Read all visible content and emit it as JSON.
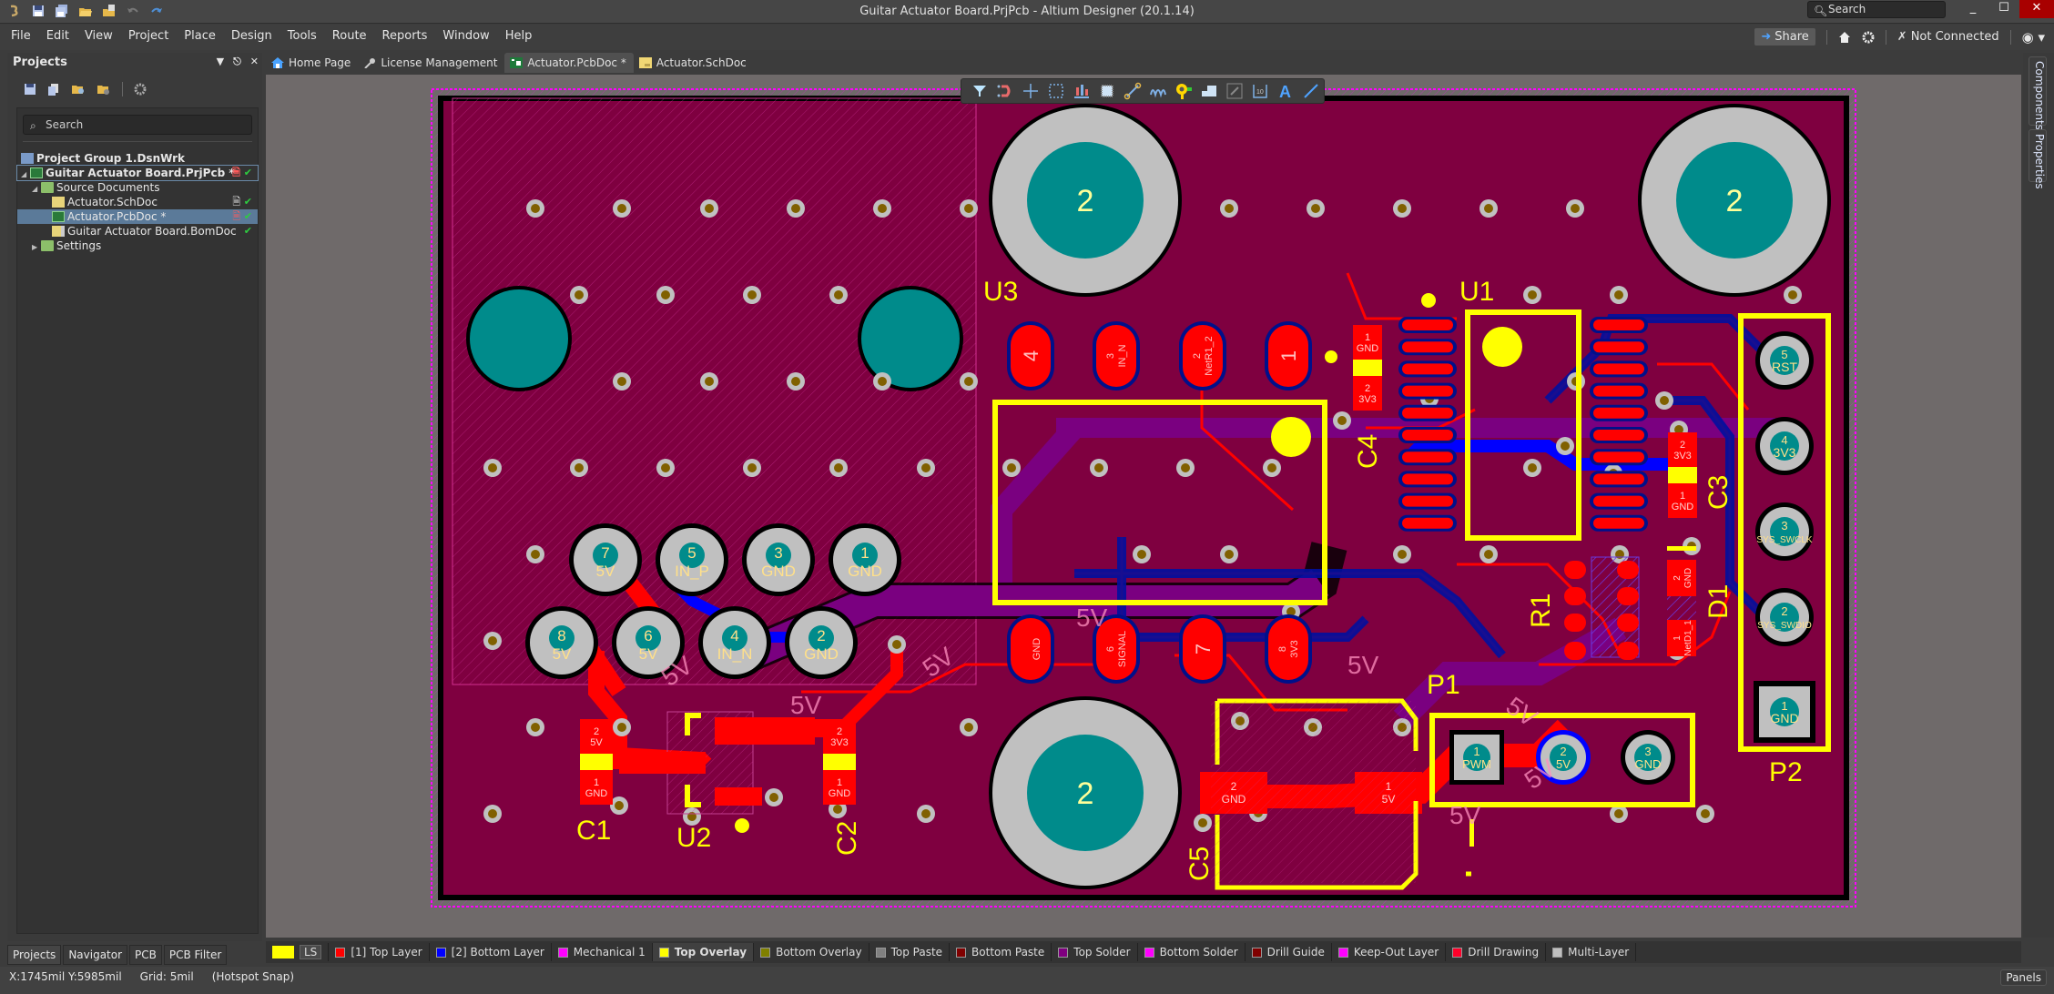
{
  "window": {
    "title": "Guitar Actuator Board.PrjPcb - Altium Designer (20.1.14)",
    "search_placeholder": "Search",
    "minimize": "_",
    "maximize": "☐",
    "close": "✕"
  },
  "menu": {
    "items": [
      "File",
      "Edit",
      "View",
      "Project",
      "Place",
      "Design",
      "Tools",
      "Route",
      "Reports",
      "Window",
      "Help"
    ],
    "share_label": "Share",
    "connection_status": "Not Connected"
  },
  "projects_panel": {
    "title": "Projects",
    "search_placeholder": "Search",
    "tree": [
      {
        "label": "Project Group 1.DsnWrk",
        "type": "group"
      },
      {
        "label": "Guitar Actuator Board.PrjPcb *",
        "type": "project",
        "modified": true,
        "status": "ok"
      },
      {
        "label": "Source Documents",
        "type": "folder"
      },
      {
        "label": "Actuator.SchDoc",
        "type": "sch",
        "status": "ok"
      },
      {
        "label": "Actuator.PcbDoc *",
        "type": "pcb",
        "modified": true,
        "selected": true,
        "status": "ok"
      },
      {
        "label": "Guitar Actuator Board.BomDoc",
        "type": "bom",
        "status": "ok"
      },
      {
        "label": "Settings",
        "type": "folder"
      }
    ]
  },
  "panel_tabs": [
    "Projects",
    "Navigator",
    "PCB",
    "PCB Filter"
  ],
  "doc_tabs": [
    {
      "label": "Home Page",
      "icon": "home-icon"
    },
    {
      "label": "License Management",
      "icon": "key-icon"
    },
    {
      "label": "Actuator.PcbDoc *",
      "icon": "pcb-doc-icon",
      "active": true
    },
    {
      "label": "Actuator.SchDoc",
      "icon": "sch-doc-icon"
    }
  ],
  "right_rail": [
    "Components",
    "Properties"
  ],
  "pcb_toolbar": [
    "filter-icon",
    "interactive-routing-icon",
    "move-crosshair-icon",
    "select-rect-icon",
    "align-icon",
    "place-component-icon",
    "route-icon",
    "length-tune-icon",
    "via-icon",
    "polygon-icon",
    "fill-icon",
    "dimension-icon",
    "string-icon",
    "line-icon"
  ],
  "layers": {
    "ls_label": "LS",
    "tabs": [
      {
        "label": "[1] Top Layer",
        "color": "#ff0000"
      },
      {
        "label": "[2] Bottom Layer",
        "color": "#0000ff"
      },
      {
        "label": "Mechanical 1",
        "color": "#ff00ff"
      },
      {
        "label": "Top Overlay",
        "color": "#ffff00",
        "active": true
      },
      {
        "label": "Bottom Overlay",
        "color": "#808000"
      },
      {
        "label": "Top Paste",
        "color": "#808080"
      },
      {
        "label": "Bottom Paste",
        "color": "#800000"
      },
      {
        "label": "Top Solder",
        "color": "#800080"
      },
      {
        "label": "Bottom Solder",
        "color": "#ff00ff"
      },
      {
        "label": "Drill Guide",
        "color": "#800000"
      },
      {
        "label": "Keep-Out Layer",
        "color": "#ff00ff"
      },
      {
        "label": "Drill Drawing",
        "color": "#ff002a"
      },
      {
        "label": "Multi-Layer",
        "color": "#c0c0c0"
      }
    ]
  },
  "status": {
    "coords": "X:1745mil Y:5985mil",
    "grid": "Grid: 5mil",
    "snap": "(Hotspot Snap)",
    "panels_label": "Panels"
  },
  "pcb": {
    "colors": {
      "board": "#7f0040",
      "top_layer": "#ff0000",
      "bottom_layer": "#0000ff",
      "overlay": "#ffff00",
      "multi_layer": "#c0c0c0",
      "drill": "#008b8b",
      "keepout": "#ff00ff"
    },
    "designators": {
      "U1": "U1",
      "U2": "U2",
      "U3": "U3",
      "C1": "C1",
      "C2": "C2",
      "C3": "C3",
      "C4": "C4",
      "C5": "C5",
      "R1": "R1",
      "D1": "D1",
      "P1": "P1",
      "P2": "P2",
      "P1_pin1_marker": "1"
    },
    "mount_hole_label": "2",
    "connector_left_pins": [
      {
        "num": "7",
        "net": "5V"
      },
      {
        "num": "5",
        "net": "IN_P"
      },
      {
        "num": "3",
        "net": "GND"
      },
      {
        "num": "1",
        "net": "GND"
      },
      {
        "num": "8",
        "net": "5V"
      },
      {
        "num": "6",
        "net": "5V"
      },
      {
        "num": "4",
        "net": "IN_N"
      },
      {
        "num": "2",
        "net": "GND"
      }
    ],
    "u3_top_pads": [
      {
        "num": "4",
        "net": ""
      },
      {
        "num": "3",
        "net": "IN_N"
      },
      {
        "num": "2",
        "net": "NetR1_2"
      },
      {
        "num": "1",
        "net": ""
      }
    ],
    "u3_bottom_pads": [
      {
        "num": "",
        "net": "GND"
      },
      {
        "num": "6",
        "net": "SIGNAL"
      },
      {
        "num": "7",
        "net": ""
      },
      {
        "num": "8",
        "net": "3V3"
      }
    ],
    "p2_pins": [
      {
        "num": "5",
        "net": "RST"
      },
      {
        "num": "4",
        "net": "3V3"
      },
      {
        "num": "3",
        "net": "SYS_SWCLK"
      },
      {
        "num": "2",
        "net": "SYS_SWDIO"
      },
      {
        "num": "1",
        "net": "GND"
      }
    ],
    "p1_pins": [
      {
        "num": "1",
        "net": "PWM"
      },
      {
        "num": "2",
        "net": "5V"
      },
      {
        "num": "3",
        "net": "GND"
      }
    ],
    "cap_pads": {
      "c1": [
        {
          "num": "2",
          "net": "5V"
        },
        {
          "num": "1",
          "net": "GND"
        }
      ],
      "c2": [
        {
          "num": "2",
          "net": "3V3"
        },
        {
          "num": "1",
          "net": "GND"
        }
      ],
      "c3": [
        {
          "num": "2",
          "net": "3V3"
        },
        {
          "num": "1",
          "net": "GND"
        }
      ],
      "c4": [
        {
          "num": "1",
          "net": "GND"
        },
        {
          "num": "2",
          "net": "3V3"
        }
      ],
      "c5": [
        {
          "num": "2",
          "net": "GND"
        },
        {
          "num": "1",
          "net": "5V"
        }
      ],
      "d1": [
        {
          "num": "2",
          "net": "GND"
        },
        {
          "num": "1",
          "net": "NetD1_1"
        }
      ]
    },
    "net_labels": {
      "five_v": "5V"
    }
  }
}
